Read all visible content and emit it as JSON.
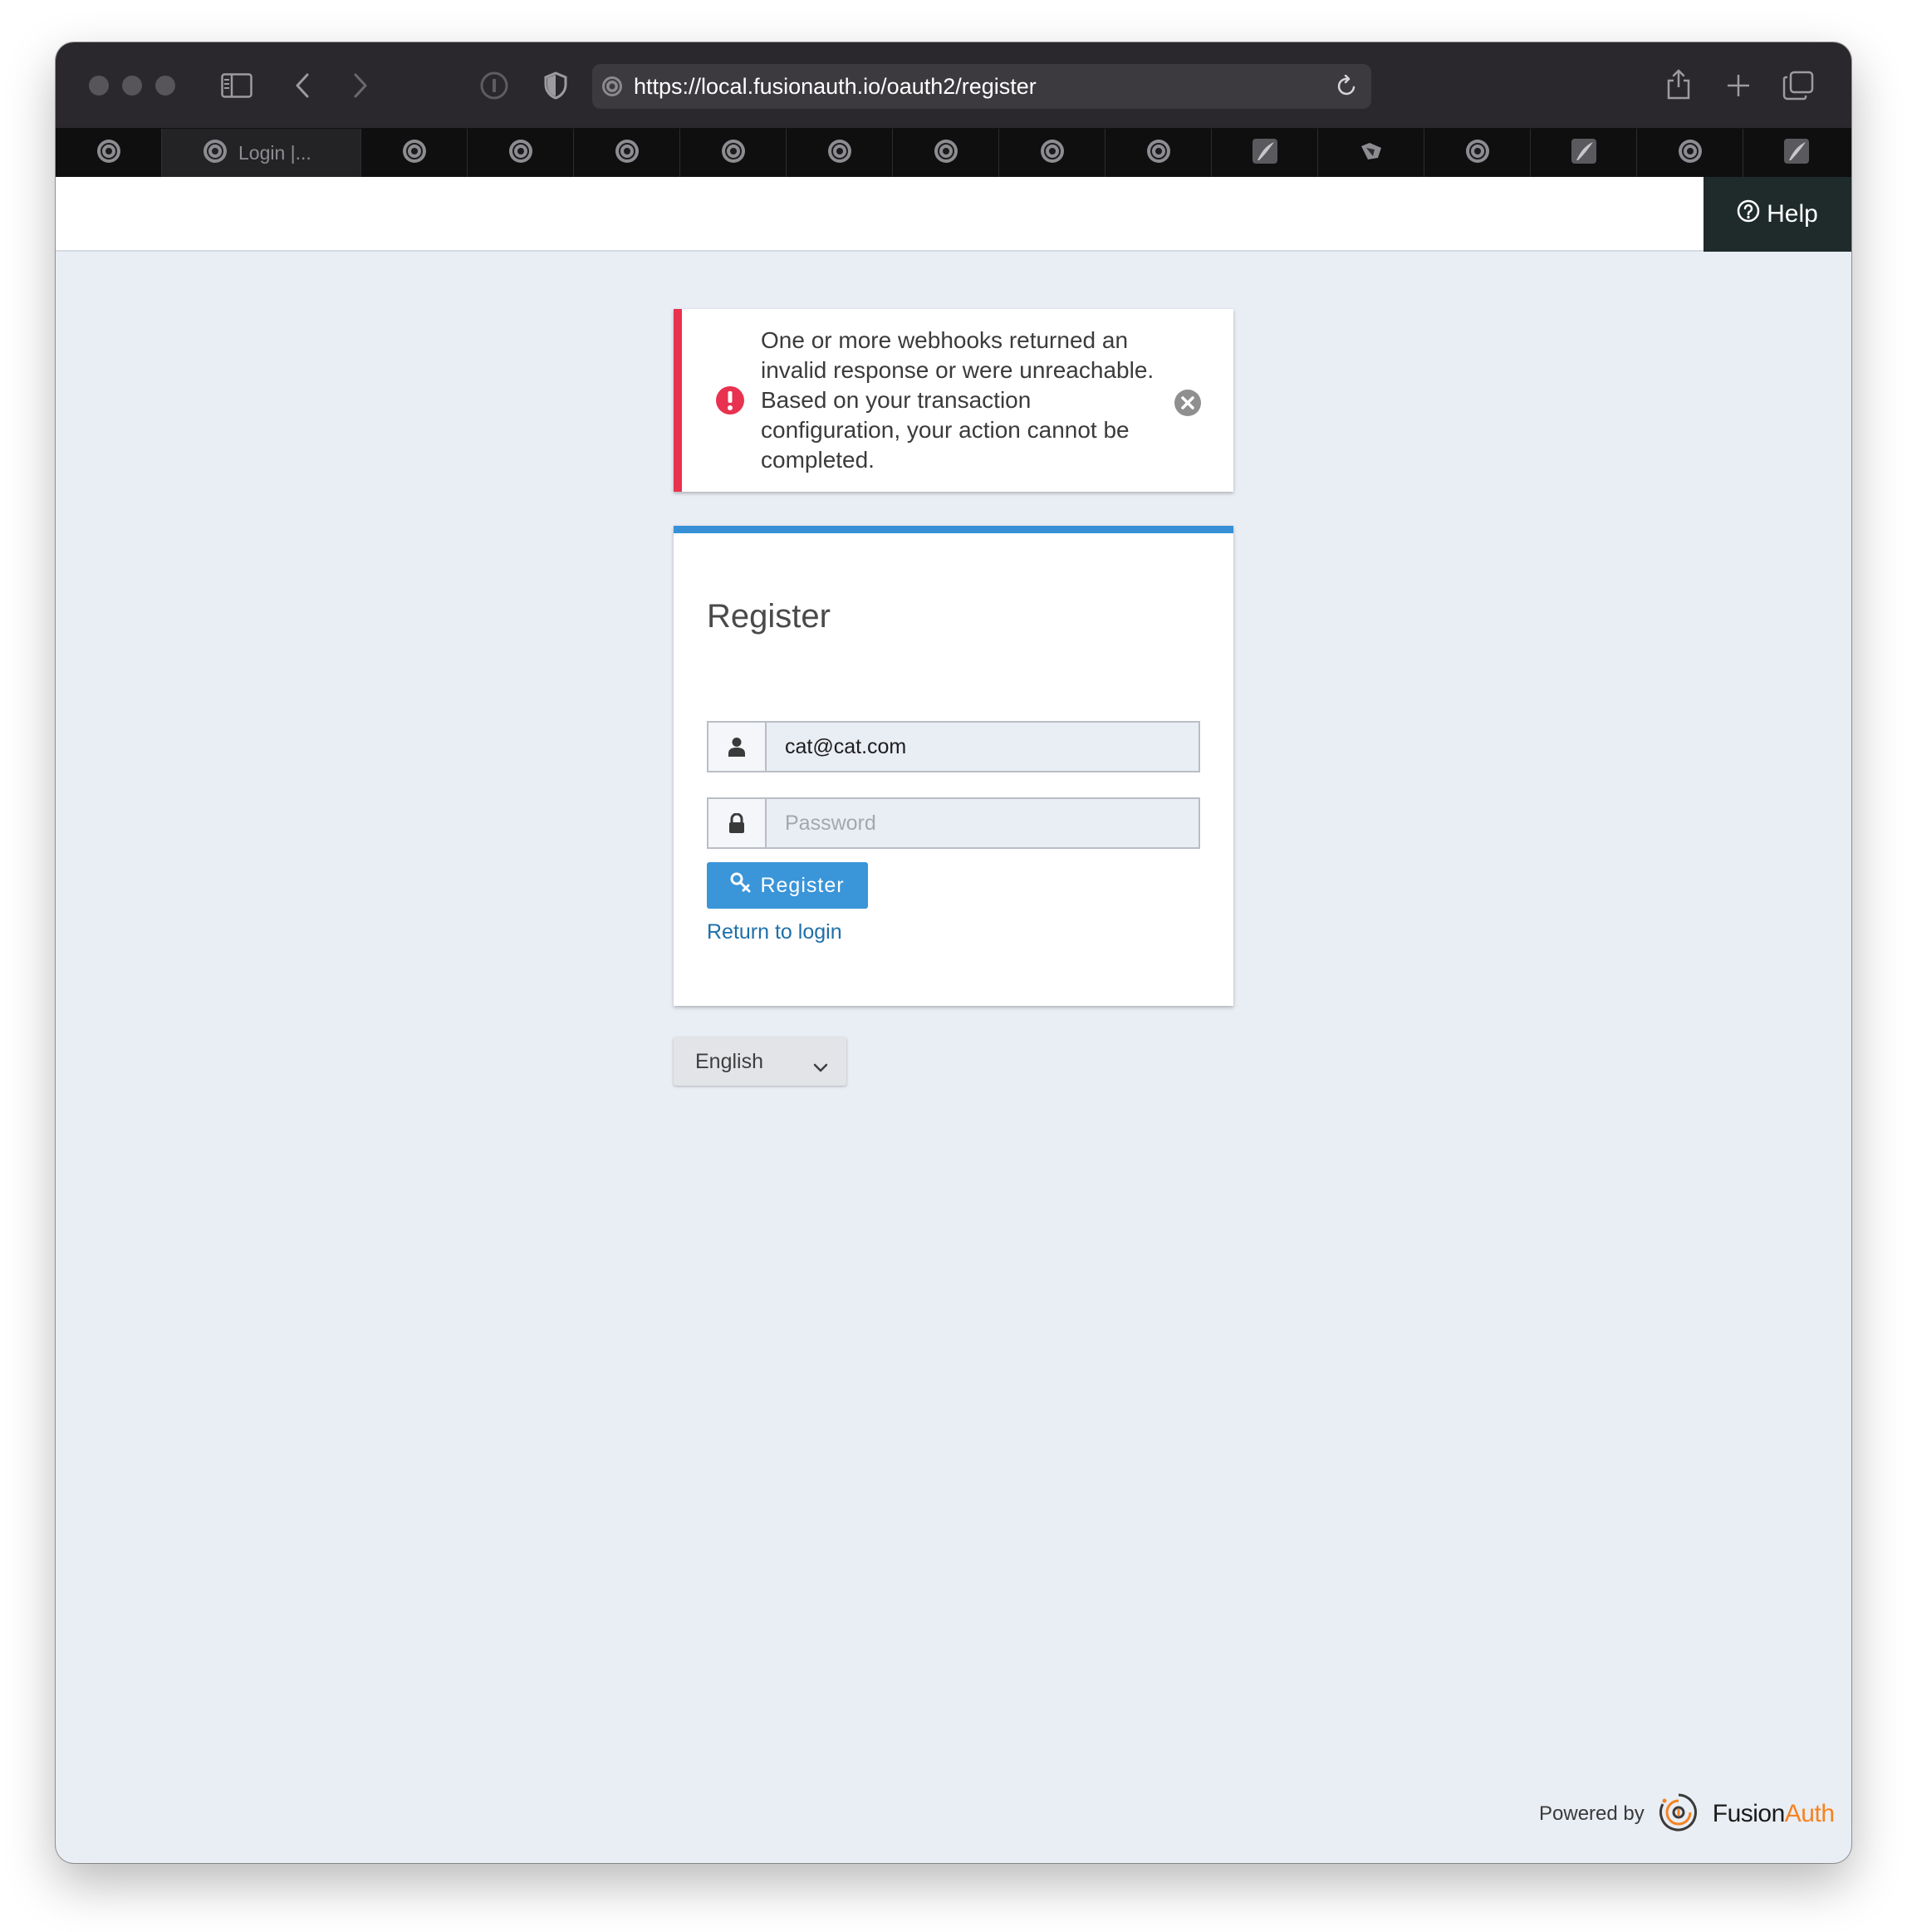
{
  "browser": {
    "url": "https://local.fusionauth.io/oauth2/register",
    "active_tab_label": "Login |..."
  },
  "header": {
    "help_label": "Help"
  },
  "alert": {
    "message": "One or more webhooks returned an invalid response or were unreachable. Based on your transaction configuration, your action cannot be completed.",
    "color": "#e8324f"
  },
  "form": {
    "title": "Register",
    "email_value": "cat@cat.com",
    "password_placeholder": "Password",
    "submit_label": "Register",
    "return_link": "Return to login",
    "accent_color": "#3a95d9"
  },
  "locale": {
    "selected": "English"
  },
  "footer": {
    "powered_by": "Powered by",
    "brand_part1": "Fusion",
    "brand_part2": "Auth",
    "brand_color": "#f58320"
  }
}
